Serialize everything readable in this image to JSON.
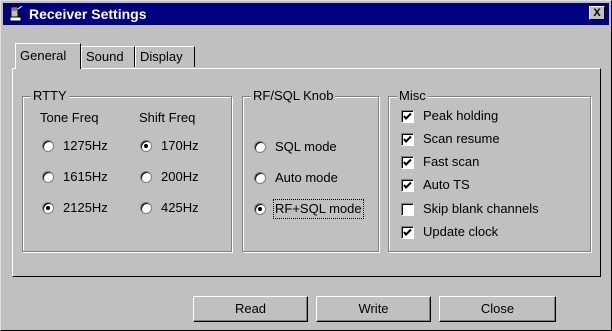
{
  "window": {
    "title": "Receiver Settings",
    "close_label": "X"
  },
  "tabs": [
    "General",
    "Sound",
    "Display"
  ],
  "rtty": {
    "legend": "RTTY",
    "tone_head": "Tone Freq",
    "shift_head": "Shift Freq",
    "tone": [
      {
        "label": "1275Hz",
        "selected": false
      },
      {
        "label": "1615Hz",
        "selected": false
      },
      {
        "label": "2125Hz",
        "selected": true
      }
    ],
    "shift": [
      {
        "label": "170Hz",
        "selected": true
      },
      {
        "label": "200Hz",
        "selected": false
      },
      {
        "label": "425Hz",
        "selected": false
      }
    ]
  },
  "knob": {
    "legend": "RF/SQL Knob",
    "options": [
      {
        "label": "SQL mode",
        "selected": false
      },
      {
        "label": "Auto mode",
        "selected": false
      },
      {
        "label": "RF+SQL mode",
        "selected": true
      }
    ]
  },
  "misc": {
    "legend": "Misc",
    "items": [
      {
        "label": "Peak holding",
        "checked": true
      },
      {
        "label": "Scan resume",
        "checked": true
      },
      {
        "label": "Fast scan",
        "checked": true
      },
      {
        "label": "Auto TS",
        "checked": true
      },
      {
        "label": "Skip blank channels",
        "checked": false
      },
      {
        "label": "Update clock",
        "checked": true
      }
    ]
  },
  "buttons": {
    "read": "Read",
    "write": "Write",
    "close": "Close"
  }
}
